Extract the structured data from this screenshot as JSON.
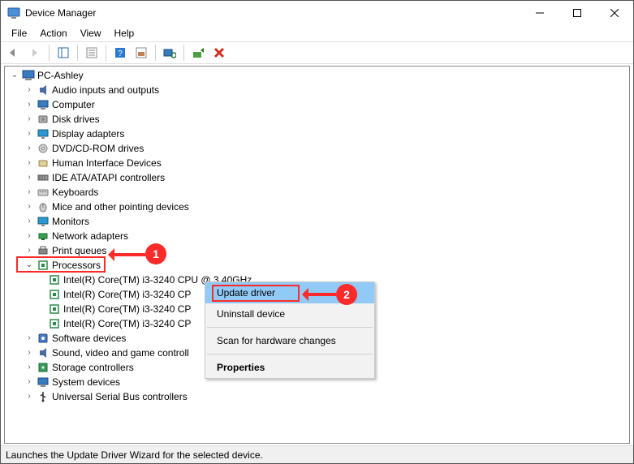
{
  "window": {
    "title": "Device Manager"
  },
  "menubar": [
    "File",
    "Action",
    "View",
    "Help"
  ],
  "root_node": "PC-Ashley",
  "categories": [
    {
      "label": "Audio inputs and outputs",
      "icon": "audio"
    },
    {
      "label": "Computer",
      "icon": "computer"
    },
    {
      "label": "Disk drives",
      "icon": "disk"
    },
    {
      "label": "Display adapters",
      "icon": "display"
    },
    {
      "label": "DVD/CD-ROM drives",
      "icon": "dvd"
    },
    {
      "label": "Human Interface Devices",
      "icon": "hid"
    },
    {
      "label": "IDE ATA/ATAPI controllers",
      "icon": "ide"
    },
    {
      "label": "Keyboards",
      "icon": "keyboard"
    },
    {
      "label": "Mice and other pointing devices",
      "icon": "mouse"
    },
    {
      "label": "Monitors",
      "icon": "monitor"
    },
    {
      "label": "Network adapters",
      "icon": "network"
    },
    {
      "label": "Print queues",
      "icon": "printer"
    }
  ],
  "processors_label": "Processors",
  "processor_items": [
    "Intel(R) Core(TM) i3-3240 CPU @ 3.40GHz",
    "Intel(R) Core(TM) i3-3240 CP",
    "Intel(R) Core(TM) i3-3240 CP",
    "Intel(R) Core(TM) i3-3240 CP"
  ],
  "categories_after": [
    {
      "label": "Software devices",
      "icon": "software"
    },
    {
      "label": "Sound, video and game controll",
      "icon": "sound"
    },
    {
      "label": "Storage controllers",
      "icon": "storage"
    },
    {
      "label": "System devices",
      "icon": "system"
    },
    {
      "label": "Universal Serial Bus controllers",
      "icon": "usb"
    }
  ],
  "context_menu": {
    "items": [
      {
        "label": "Update driver",
        "selected": true
      },
      {
        "label": "Uninstall device"
      },
      {
        "sep": true
      },
      {
        "label": "Scan for hardware changes"
      },
      {
        "sep": true
      },
      {
        "label": "Properties",
        "bold": true
      }
    ]
  },
  "callouts": {
    "1": "1",
    "2": "2"
  },
  "statusbar": "Launches the Update Driver Wizard for the selected device."
}
